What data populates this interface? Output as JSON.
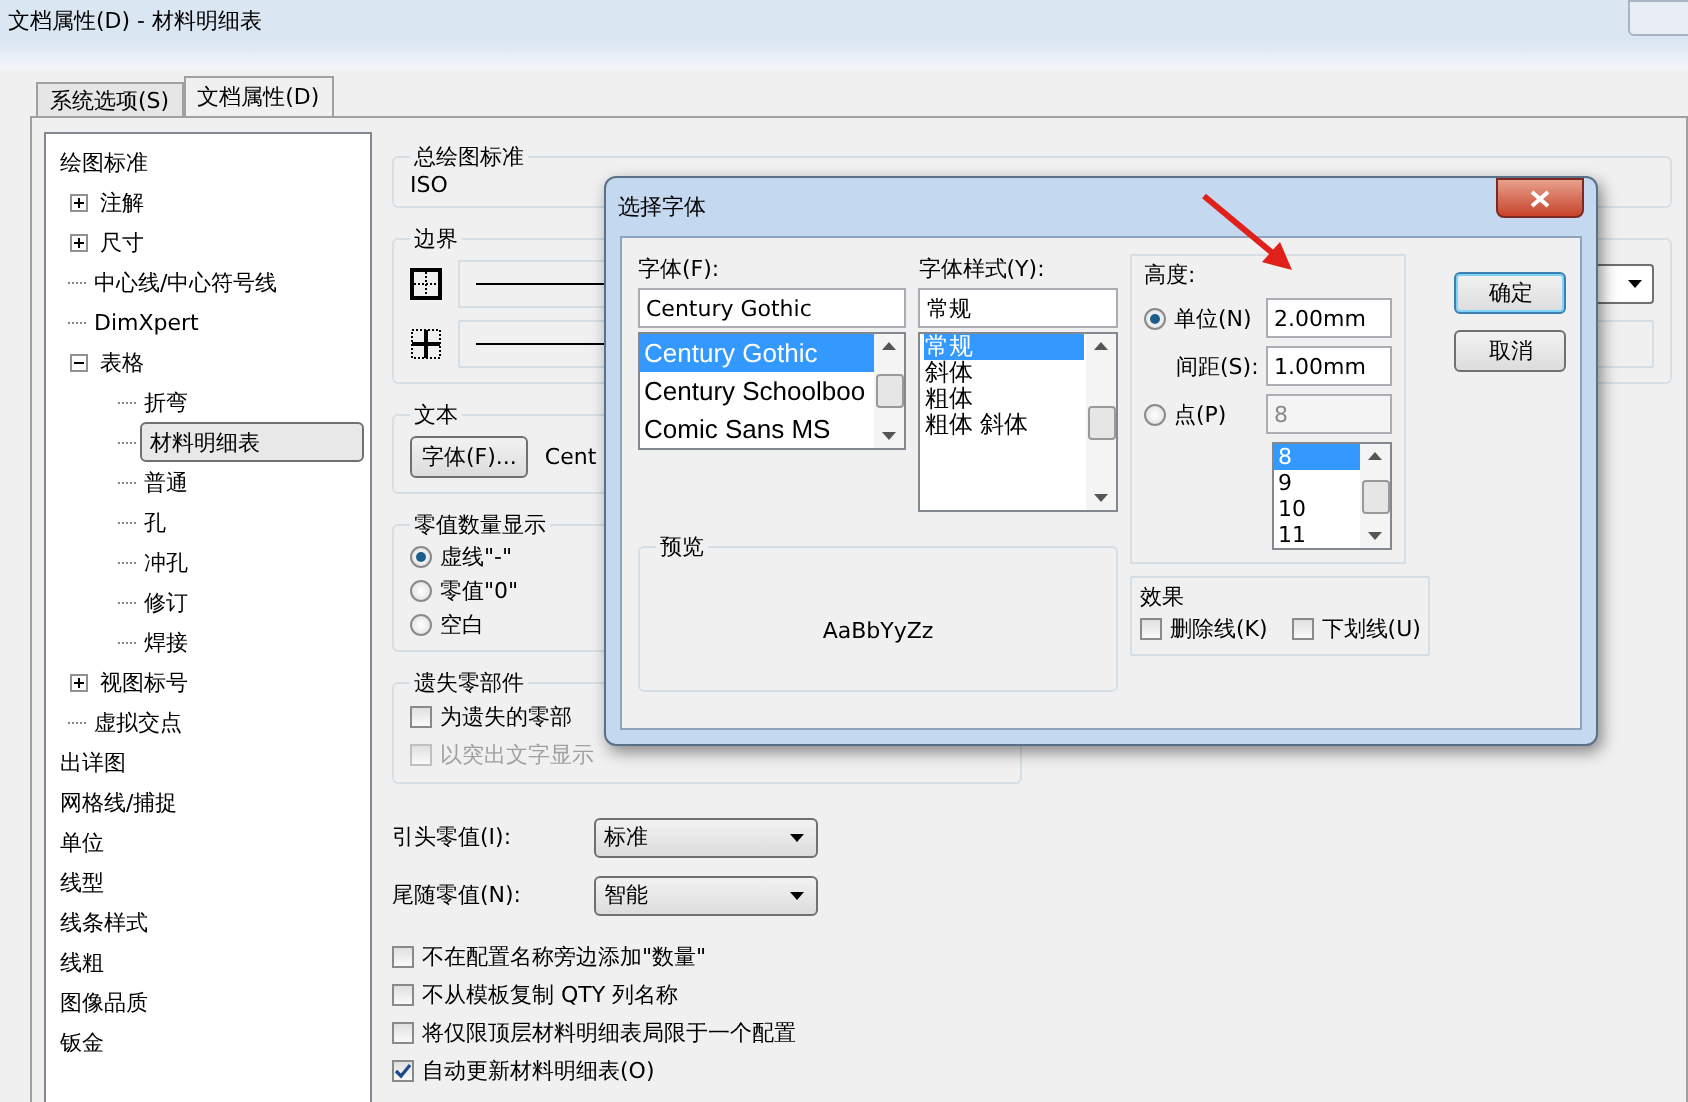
{
  "window": {
    "title": "文档属性(D) - 材料明细表"
  },
  "tabs": [
    {
      "label": "系统选项(S)",
      "selected": false
    },
    {
      "label": "文档属性(D)",
      "selected": true
    }
  ],
  "tree": [
    {
      "label": "绘图标准",
      "selected": false,
      "children": [
        {
          "label": "注解",
          "selected": false,
          "expanded": false
        },
        {
          "label": "尺寸",
          "selected": false,
          "expanded": false
        },
        {
          "label": "中心线/中心符号线",
          "selected": false
        },
        {
          "label": "DimXpert",
          "selected": false
        },
        {
          "label": "表格",
          "selected": false,
          "expanded": true,
          "children": [
            {
              "label": "折弯",
              "selected": false
            },
            {
              "label": "材料明细表",
              "selected": true
            },
            {
              "label": "普通",
              "selected": false
            },
            {
              "label": "孔",
              "selected": false
            },
            {
              "label": "冲孔",
              "selected": false
            },
            {
              "label": "修订",
              "selected": false
            },
            {
              "label": "焊接",
              "selected": false
            }
          ]
        },
        {
          "label": "视图标号",
          "selected": false,
          "expanded": false
        },
        {
          "label": "虚拟交点",
          "selected": false
        }
      ]
    },
    {
      "label": "出详图",
      "selected": false
    },
    {
      "label": "网格线/捕捉",
      "selected": false
    },
    {
      "label": "单位",
      "selected": false
    },
    {
      "label": "线型",
      "selected": false
    },
    {
      "label": "线条样式",
      "selected": false
    },
    {
      "label": "线粗",
      "selected": false
    },
    {
      "label": "图像品质",
      "selected": false
    },
    {
      "label": "钣金",
      "selected": false
    }
  ],
  "drawing_standard": {
    "title": "总绘图标准",
    "value": "ISO"
  },
  "border": {
    "title": "边界"
  },
  "text": {
    "title": "文本",
    "font_button": "字体(F)...",
    "font_name": "Cent"
  },
  "zero_display": {
    "title": "零值数量显示",
    "options": [
      {
        "label": "虚线\"-\"",
        "selected": true
      },
      {
        "label": "零值\"0\"",
        "selected": false
      },
      {
        "label": "空白",
        "selected": false
      }
    ]
  },
  "missing_components": {
    "title": "遗失零部件",
    "options": [
      {
        "label": "为遗失的零部",
        "checked": false,
        "disabled": false
      },
      {
        "label": "以突出文字显示",
        "checked": false,
        "disabled": true
      }
    ]
  },
  "dropdowns": [
    {
      "label": "引头零值(I):",
      "value": "标准"
    },
    {
      "label": "尾随零值(N):",
      "value": "智能"
    }
  ],
  "options": [
    {
      "label": "不在配置名称旁边添加\"数量\"",
      "checked": false
    },
    {
      "label": "不从模板复制 QTY 列名称",
      "checked": false
    },
    {
      "label": "将仅限顶层材料明细表局限于一个配置",
      "checked": false
    },
    {
      "label": "自动更新材料明细表(O)",
      "checked": true
    }
  ],
  "font_dialog": {
    "title": "选择字体",
    "font_label": "字体(F):",
    "font_value": "Century Gothic",
    "fonts": [
      {
        "label": "Century Gothic",
        "selected": true
      },
      {
        "label": "Century Schoolboo",
        "selected": false
      },
      {
        "label": "Comic Sans MS",
        "selected": false
      }
    ],
    "style_label": "字体样式(Y):",
    "style_value": "常规",
    "styles": [
      {
        "label": "常规",
        "selected": true
      },
      {
        "label": "斜体",
        "selected": false
      },
      {
        "label": "粗体",
        "selected": false
      },
      {
        "label": "粗体 斜体",
        "selected": false
      }
    ],
    "preview_label": "预览",
    "preview_text": "AaBbYyZz",
    "height_label": "高度:",
    "units": {
      "label": "单位(N)",
      "selected": true,
      "value": "2.00mm"
    },
    "spacing": {
      "label": "间距(S):",
      "value": "1.00mm"
    },
    "points": {
      "label": "点(P)",
      "selected": false,
      "disabled": true,
      "value": "8",
      "sizes": [
        {
          "label": "8",
          "selected": true
        },
        {
          "label": "9",
          "selected": false
        },
        {
          "label": "10",
          "selected": false
        },
        {
          "label": "11",
          "selected": false
        }
      ]
    },
    "effects_label": "效果",
    "effects": [
      {
        "label": "删除线(K)",
        "checked": false
      },
      {
        "label": "下划线(U)",
        "checked": false
      }
    ],
    "buttons": [
      {
        "label": "确定",
        "default": true
      },
      {
        "label": "取消",
        "default": false
      }
    ]
  }
}
